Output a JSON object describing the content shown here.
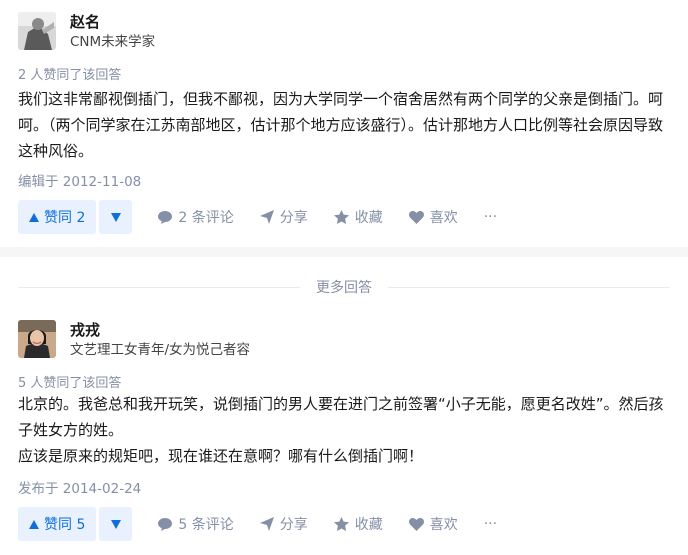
{
  "answers": [
    {
      "author": {
        "name": "赵名",
        "headline": "CNM未来学家"
      },
      "votes_text": "2 人赞同了该回答",
      "content": [
        "我们这非常鄙视倒插门，但我不鄙视，因为大学同学一个宿舍居然有两个同学的父亲是倒插门。呵呵。（两个同学家在江苏南部地区，估计那个地方应该盛行）。估计那地方人口比例等社会原因导致这种风俗。"
      ],
      "time": "编辑于 2012-11-08",
      "actions": {
        "vote_up": "赞同 2",
        "comments": "2 条评论",
        "share": "分享",
        "collect": "收藏",
        "like": "喜欢",
        "more": "···"
      }
    },
    {
      "author": {
        "name": "戎戎",
        "headline": "文艺理工女青年/女为悦己者容"
      },
      "votes_text": "5 人赞同了该回答",
      "content": [
        "北京的。我爸总和我开玩笑，说倒插门的男人要在进门之前签署“小子无能，愿更名改姓”。然后孩子姓女方的姓。",
        "应该是原来的规矩吧，现在谁还在意啊？哪有什么倒插门啊！"
      ],
      "time": "发布于 2014-02-24",
      "actions": {
        "vote_up": "赞同 5",
        "comments": "5 条评论",
        "share": "分享",
        "collect": "收藏",
        "like": "喜欢",
        "more": "···"
      }
    }
  ],
  "more_answers_label": "更多回答",
  "colors": {
    "accent": "#0f6fd9",
    "vote_bg": "#e8f1fd",
    "muted": "#8590a6"
  }
}
